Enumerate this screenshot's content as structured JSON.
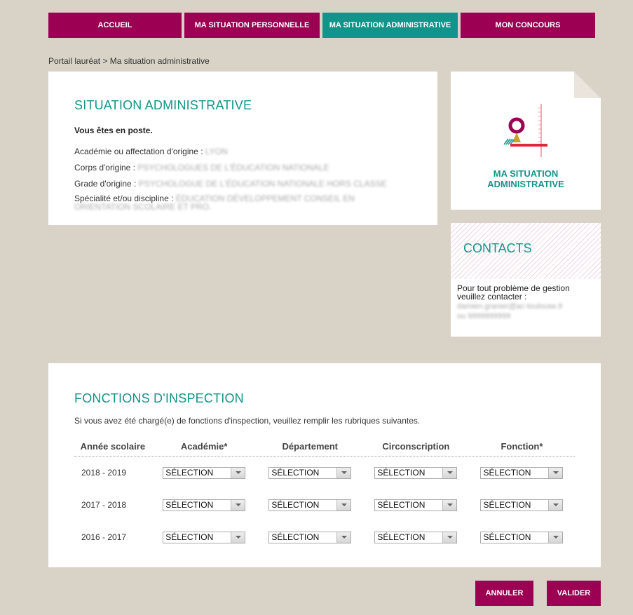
{
  "nav": {
    "tabs": [
      {
        "label": "ACCUEIL",
        "active": false
      },
      {
        "label": "MA SITUATION PERSONNELLE",
        "active": false
      },
      {
        "label": "MA SITUATION ADMINISTRATIVE",
        "active": true
      },
      {
        "label": "MON CONCOURS",
        "active": false
      }
    ]
  },
  "breadcrumb": "Portail lauréat > Ma situation administrative",
  "situation": {
    "title": "SITUATION ADMINISTRATIVE",
    "status": "Vous êtes en poste.",
    "academie_label": "Académie ou affectation d'origine :",
    "academie_value": "LYON",
    "corps_label": "Corps d'origine :",
    "corps_value": "PSYCHOLOGUES DE L'ÉDUCATION NATIONALE",
    "grade_label": "Grade d'origine :",
    "grade_value": "PSYCHOLOGUE DE L'ÉDUCATION NATIONALE HORS CLASSE",
    "specialite_label": "Spécialité et/ou discipline :",
    "specialite_value": "ÉDUCATION DÉVELOPPEMENT CONSEIL EN ORIENTATION SCOLAIRE ET PRO."
  },
  "side_card": {
    "label_line1": "MA SITUATION",
    "label_line2": "ADMINISTRATIVE",
    "icon": "administrative-situation-icon"
  },
  "contacts": {
    "title": "CONTACTS",
    "text": "Pour tout problème de gestion veuillez contacter :",
    "email": "damien.granier@ac-toulouse.fr",
    "phone": "ou 9999999999"
  },
  "inspection": {
    "title": "FONCTIONS D'INSPECTION",
    "intro": "Si vous avez été chargé(e) de fonctions d'inspection, veuillez remplir les rubriques suivantes.",
    "headers": [
      "Année scolaire",
      "Académie*",
      "Département",
      "Circonscription",
      "Fonction*"
    ],
    "rows": [
      {
        "year": "2018 - 2019",
        "academie": "SÉLECTION",
        "departement": "SÉLECTION",
        "circonscription": "SÉLECTION",
        "fonction": "SÉLECTION"
      },
      {
        "year": "2017 - 2018",
        "academie": "SÉLECTION",
        "departement": "SÉLECTION",
        "circonscription": "SÉLECTION",
        "fonction": "SÉLECTION"
      },
      {
        "year": "2016 - 2017",
        "academie": "SÉLECTION",
        "departement": "SÉLECTION",
        "circonscription": "SÉLECTION",
        "fonction": "SÉLECTION"
      }
    ]
  },
  "actions": {
    "cancel": "ANNULER",
    "submit": "VALIDER"
  },
  "colors": {
    "purple": "#9b0052",
    "teal": "#12948a",
    "background": "#d9d3c7"
  }
}
